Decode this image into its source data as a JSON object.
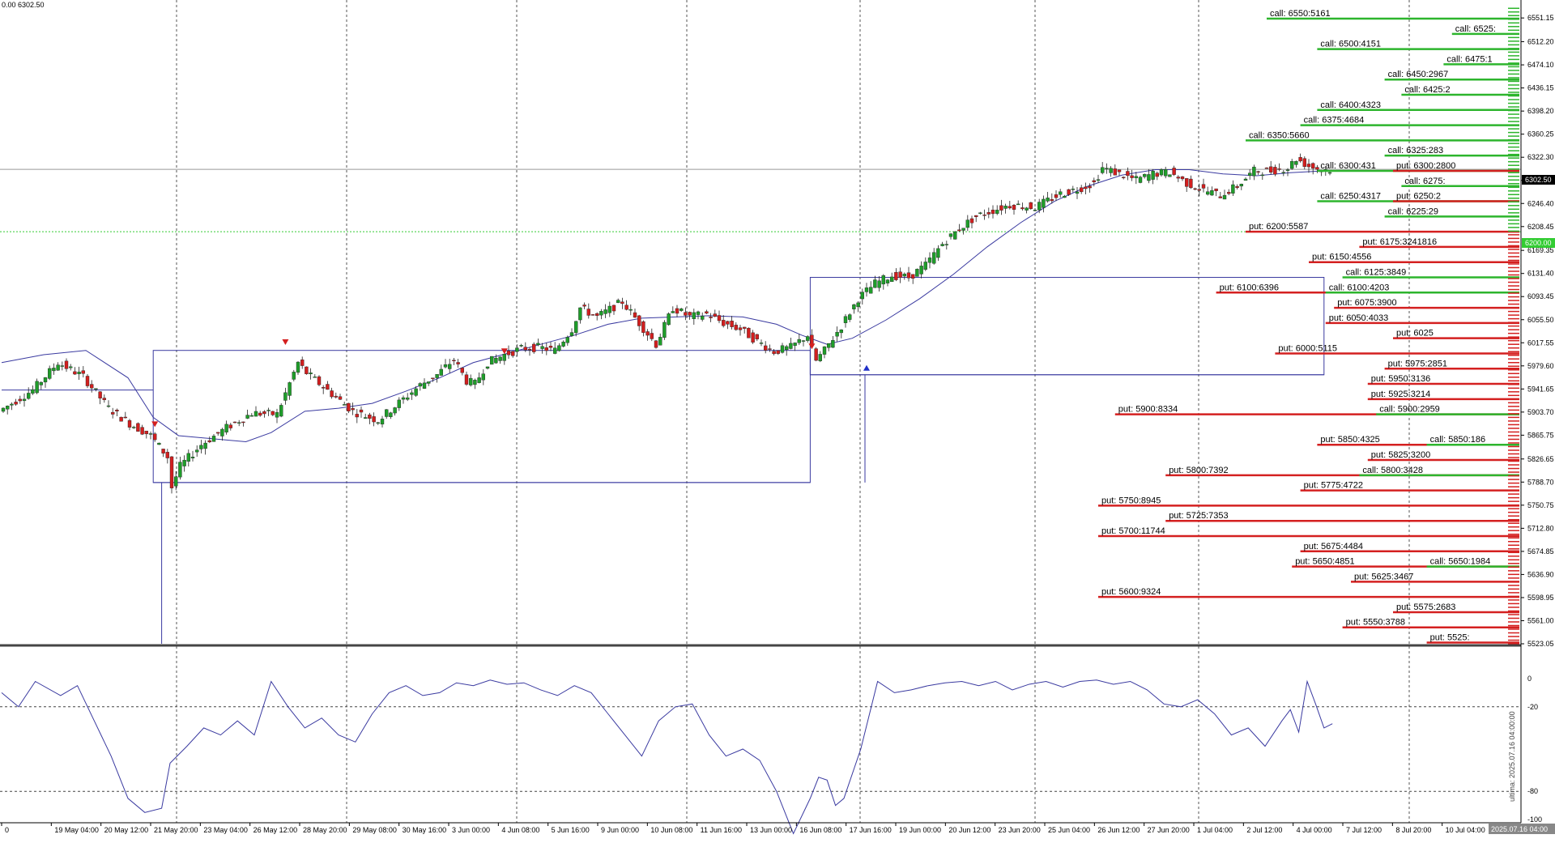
{
  "chart_header": "0.00 6302.50",
  "current_price_label": "6302.50",
  "level_marker_label": "6200.00",
  "vertical_caption": "ultima: 2025.07.16 04:00:00",
  "corner_date_label": "2025.07.16 04:00",
  "colors": {
    "background": "#ffffff",
    "bull": "#1f9d2a",
    "bear": "#d21f1f",
    "ma": "#3a3aa0",
    "call_line": "#2db52d",
    "put_line": "#d42020",
    "grid": "#555555",
    "level_marker": "#33cc33",
    "indicator": "#3a3aa0"
  },
  "chart_data": {
    "type": "candlestick",
    "price_axis": {
      "ylim": [
        5523.05,
        6570
      ],
      "ticks": [
        "6551.15",
        "6512.20",
        "6474.10",
        "6436.15",
        "6398.20",
        "6360.25",
        "6322.30",
        "6284.35",
        "6246.40",
        "6208.45",
        "6169.35",
        "6131.40",
        "6093.45",
        "6055.50",
        "6017.55",
        "5979.60",
        "5941.65",
        "5903.70",
        "5865.75",
        "5826.65",
        "5788.70",
        "5750.75",
        "5712.80",
        "5674.85",
        "5636.90",
        "5598.95",
        "5561.00",
        "5523.05"
      ]
    },
    "time_axis": {
      "labels": [
        "0",
        "19 May 04:00",
        "20 May 12:00",
        "21 May 20:00",
        "23 May 04:00",
        "26 May 12:00",
        "28 May 20:00",
        "29 May 08:00",
        "30 May 16:00",
        "3 Jun 00:00",
        "4 Jun 08:00",
        "5 Jun 16:00",
        "9 Jun 00:00",
        "10 Jun 08:00",
        "11 Jun 16:00",
        "13 Jun 00:00",
        "16 Jun 08:00",
        "17 Jun 16:00",
        "19 Jun 00:00",
        "20 Jun 12:00",
        "23 Jun 20:00",
        "25 Jun 04:00",
        "26 Jun 12:00",
        "27 Jun 20:00",
        "1 Jul 04:00",
        "2 Jul 12:00",
        "4 Jul 00:00",
        "7 Jul 12:00",
        "8 Jul 20:00",
        "10 Jul 04:00"
      ]
    },
    "price_path": [
      [
        0,
        5905
      ],
      [
        8,
        5940
      ],
      [
        14,
        5985
      ],
      [
        20,
        5962
      ],
      [
        26,
        5910
      ],
      [
        31,
        5885
      ],
      [
        36,
        5865
      ],
      [
        40,
        5830
      ],
      [
        41,
        5780
      ],
      [
        43,
        5815
      ],
      [
        48,
        5850
      ],
      [
        54,
        5878
      ],
      [
        60,
        5902
      ],
      [
        66,
        5900
      ],
      [
        71,
        5985
      ],
      [
        73,
        5968
      ],
      [
        77,
        5945
      ],
      [
        84,
        5905
      ],
      [
        90,
        5890
      ],
      [
        96,
        5925
      ],
      [
        100,
        5948
      ],
      [
        104,
        5965
      ],
      [
        108,
        5990
      ],
      [
        111,
        5955
      ],
      [
        113,
        5950
      ],
      [
        116,
        5985
      ],
      [
        120,
        5998
      ],
      [
        124,
        6008
      ],
      [
        128,
        6010
      ],
      [
        132,
        6005
      ],
      [
        136,
        6040
      ],
      [
        138,
        6075
      ],
      [
        142,
        6060
      ],
      [
        148,
        6085
      ],
      [
        152,
        6050
      ],
      [
        156,
        6015
      ],
      [
        160,
        6075
      ],
      [
        164,
        6060
      ],
      [
        168,
        6065
      ],
      [
        172,
        6050
      ],
      [
        176,
        6040
      ],
      [
        180,
        6020
      ],
      [
        184,
        6003
      ],
      [
        188,
        6010
      ],
      [
        192,
        6030
      ],
      [
        194,
        5988
      ],
      [
        196,
        6005
      ],
      [
        200,
        6045
      ],
      [
        204,
        6090
      ],
      [
        208,
        6115
      ],
      [
        212,
        6128
      ],
      [
        216,
        6125
      ],
      [
        220,
        6145
      ],
      [
        224,
        6180
      ],
      [
        228,
        6205
      ],
      [
        232,
        6225
      ],
      [
        236,
        6235
      ],
      [
        240,
        6244
      ],
      [
        246,
        6240
      ],
      [
        252,
        6262
      ],
      [
        256,
        6270
      ],
      [
        260,
        6280
      ],
      [
        262,
        6305
      ],
      [
        266,
        6295
      ],
      [
        270,
        6285
      ],
      [
        274,
        6295
      ],
      [
        278,
        6298
      ],
      [
        282,
        6280
      ],
      [
        286,
        6268
      ],
      [
        290,
        6260
      ],
      [
        294,
        6275
      ],
      [
        298,
        6300
      ],
      [
        302,
        6300
      ],
      [
        306,
        6305
      ],
      [
        308,
        6320
      ],
      [
        311,
        6308
      ],
      [
        314,
        6302
      ]
    ],
    "moving_average": [
      [
        0,
        5985
      ],
      [
        10,
        5998
      ],
      [
        20,
        6005
      ],
      [
        30,
        5960
      ],
      [
        36,
        5895
      ],
      [
        42,
        5865
      ],
      [
        50,
        5860
      ],
      [
        58,
        5855
      ],
      [
        64,
        5870
      ],
      [
        72,
        5905
      ],
      [
        80,
        5910
      ],
      [
        88,
        5918
      ],
      [
        96,
        5938
      ],
      [
        104,
        5960
      ],
      [
        112,
        5985
      ],
      [
        120,
        6000
      ],
      [
        128,
        6015
      ],
      [
        136,
        6030
      ],
      [
        144,
        6048
      ],
      [
        152,
        6058
      ],
      [
        160,
        6060
      ],
      [
        168,
        6062
      ],
      [
        176,
        6060
      ],
      [
        184,
        6048
      ],
      [
        190,
        6030
      ],
      [
        196,
        6015
      ],
      [
        202,
        6025
      ],
      [
        210,
        6055
      ],
      [
        218,
        6090
      ],
      [
        226,
        6130
      ],
      [
        234,
        6175
      ],
      [
        242,
        6215
      ],
      [
        250,
        6250
      ],
      [
        258,
        6275
      ],
      [
        266,
        6293
      ],
      [
        274,
        6302
      ],
      [
        282,
        6302
      ],
      [
        290,
        6295
      ],
      [
        298,
        6292
      ],
      [
        306,
        6297
      ],
      [
        314,
        6300
      ]
    ],
    "range_boxes": [
      {
        "x": [
          0,
          36
        ],
        "y": [
          5940,
          5940
        ]
      },
      {
        "x": [
          36,
          192
        ],
        "y": [
          5788,
          6005
        ]
      },
      {
        "x": [
          192,
          314
        ],
        "y": [
          5965,
          6125
        ]
      }
    ],
    "signal_arrows": [
      {
        "bar": 36,
        "type": "sell",
        "price": 5875
      },
      {
        "bar": 67,
        "type": "sell",
        "price": 6010
      },
      {
        "bar": 119,
        "type": "sell",
        "price": 5995
      },
      {
        "bar": 192,
        "type": "sell",
        "price": 6003
      },
      {
        "bar": 205,
        "type": "buy",
        "price": 5985
      }
    ],
    "indicator": {
      "ylim": [
        -100,
        0
      ],
      "ticks": [
        "0",
        "-20",
        "-80",
        "-100"
      ],
      "levels": [
        -20,
        -80
      ],
      "values": [
        [
          0,
          -10
        ],
        [
          4,
          -20
        ],
        [
          8,
          -2
        ],
        [
          14,
          -12
        ],
        [
          18,
          -5
        ],
        [
          22,
          -30
        ],
        [
          26,
          -55
        ],
        [
          30,
          -85
        ],
        [
          34,
          -95
        ],
        [
          38,
          -92
        ],
        [
          40,
          -60
        ],
        [
          44,
          -48
        ],
        [
          48,
          -35
        ],
        [
          52,
          -40
        ],
        [
          56,
          -30
        ],
        [
          60,
          -40
        ],
        [
          64,
          -2
        ],
        [
          68,
          -20
        ],
        [
          72,
          -35
        ],
        [
          76,
          -28
        ],
        [
          80,
          -40
        ],
        [
          84,
          -45
        ],
        [
          88,
          -25
        ],
        [
          92,
          -10
        ],
        [
          96,
          -5
        ],
        [
          100,
          -12
        ],
        [
          104,
          -10
        ],
        [
          108,
          -3
        ],
        [
          112,
          -5
        ],
        [
          116,
          -1
        ],
        [
          120,
          -4
        ],
        [
          124,
          -3
        ],
        [
          128,
          -8
        ],
        [
          132,
          -12
        ],
        [
          136,
          -5
        ],
        [
          140,
          -10
        ],
        [
          144,
          -25
        ],
        [
          148,
          -40
        ],
        [
          152,
          -55
        ],
        [
          156,
          -30
        ],
        [
          160,
          -20
        ],
        [
          164,
          -18
        ],
        [
          168,
          -40
        ],
        [
          172,
          -55
        ],
        [
          176,
          -50
        ],
        [
          180,
          -58
        ],
        [
          184,
          -80
        ],
        [
          188,
          -110
        ],
        [
          192,
          -85
        ],
        [
          194,
          -70
        ],
        [
          196,
          -72
        ],
        [
          198,
          -90
        ],
        [
          200,
          -85
        ],
        [
          204,
          -50
        ],
        [
          208,
          -2
        ],
        [
          212,
          -10
        ],
        [
          216,
          -8
        ],
        [
          220,
          -5
        ],
        [
          224,
          -3
        ],
        [
          228,
          -2
        ],
        [
          232,
          -5
        ],
        [
          236,
          -2
        ],
        [
          240,
          -8
        ],
        [
          244,
          -4
        ],
        [
          248,
          -2
        ],
        [
          252,
          -6
        ],
        [
          256,
          -2
        ],
        [
          260,
          -1
        ],
        [
          264,
          -4
        ],
        [
          268,
          -2
        ],
        [
          272,
          -8
        ],
        [
          276,
          -18
        ],
        [
          280,
          -20
        ],
        [
          284,
          -15
        ],
        [
          288,
          -25
        ],
        [
          292,
          -40
        ],
        [
          296,
          -35
        ],
        [
          300,
          -48
        ],
        [
          304,
          -30
        ],
        [
          306,
          -22
        ],
        [
          308,
          -38
        ],
        [
          310,
          -2
        ],
        [
          312,
          -18
        ],
        [
          314,
          -35
        ],
        [
          316,
          -32
        ]
      ]
    },
    "option_levels": [
      {
        "label": "call: 6550:5161",
        "type": "call",
        "strike": 6550,
        "length": 0.6
      },
      {
        "label": "call: 6525:",
        "type": "call",
        "strike": 6525,
        "length": 0.16
      },
      {
        "label": "call: 6500:4151",
        "type": "call",
        "strike": 6500,
        "length": 0.48
      },
      {
        "label": "call: 6475:1",
        "type": "call",
        "strike": 6475,
        "length": 0.18
      },
      {
        "label": "call: 6450:2967",
        "type": "call",
        "strike": 6450,
        "length": 0.32
      },
      {
        "label": "call: 6425:2",
        "type": "call",
        "strike": 6425,
        "length": 0.28
      },
      {
        "label": "call: 6400:4323",
        "type": "call",
        "strike": 6400,
        "length": 0.48
      },
      {
        "label": "call: 6375:4684",
        "type": "call",
        "strike": 6375,
        "length": 0.52
      },
      {
        "label": "call: 6350:5660",
        "type": "call",
        "strike": 6350,
        "length": 0.65
      },
      {
        "label": "call: 6325:283",
        "type": "call",
        "strike": 6325,
        "length": 0.32
      },
      {
        "label": "call: 6300:431",
        "type": "call",
        "strike": 6300,
        "length": 0.48
      },
      {
        "label": "put: 6300:2800",
        "type": "put",
        "strike": 6300,
        "length": 0.3
      },
      {
        "label": "call: 6275:",
        "type": "call",
        "strike": 6275,
        "length": 0.28
      },
      {
        "label": "call: 6250:4317",
        "type": "call",
        "strike": 6250,
        "length": 0.48
      },
      {
        "label": "put: 6250:2",
        "type": "put",
        "strike": 6250,
        "length": 0.3
      },
      {
        "label": "call: 6225:29",
        "type": "call",
        "strike": 6225,
        "length": 0.32
      },
      {
        "label": "put: 6200:5587",
        "type": "put",
        "strike": 6200,
        "length": 0.65
      },
      {
        "label": "put: 6175:3241816",
        "type": "put",
        "strike": 6175,
        "length": 0.38
      },
      {
        "label": "put: 6150:4556",
        "type": "put",
        "strike": 6150,
        "length": 0.5
      },
      {
        "label": "call: 6125:3849",
        "type": "call",
        "strike": 6125,
        "length": 0.42
      },
      {
        "label": "put: 6100:6396",
        "type": "put",
        "strike": 6100,
        "length": 0.72
      },
      {
        "label": "call: 6100:4203",
        "type": "call",
        "strike": 6100,
        "length": 0.46
      },
      {
        "label": "put: 6075:3900",
        "type": "put",
        "strike": 6075,
        "length": 0.44
      },
      {
        "label": "put: 6050:4033",
        "type": "put",
        "strike": 6050,
        "length": 0.46
      },
      {
        "label": "put: 6025",
        "type": "put",
        "strike": 6025,
        "length": 0.3
      },
      {
        "label": "put: 6000:5115",
        "type": "put",
        "strike": 6000,
        "length": 0.58
      },
      {
        "label": "put: 5975:2851",
        "type": "put",
        "strike": 5975,
        "length": 0.32
      },
      {
        "label": "put: 5950:3136",
        "type": "put",
        "strike": 5950,
        "length": 0.36
      },
      {
        "label": "put: 5925:3214",
        "type": "put",
        "strike": 5925,
        "length": 0.36
      },
      {
        "label": "put: 5900:8334",
        "type": "put",
        "strike": 5900,
        "length": 0.96
      },
      {
        "label": "call: 5900:2959",
        "type": "call",
        "strike": 5900,
        "length": 0.34
      },
      {
        "label": "put: 5850:4325",
        "type": "put",
        "strike": 5850,
        "length": 0.48
      },
      {
        "label": "call: 5850:186",
        "type": "call",
        "strike": 5850,
        "length": 0.22
      },
      {
        "label": "put: 5825:3200",
        "type": "put",
        "strike": 5825,
        "length": 0.36
      },
      {
        "label": "put: 5800:7392",
        "type": "put",
        "strike": 5800,
        "length": 0.84
      },
      {
        "label": "call: 5800:3428",
        "type": "call",
        "strike": 5800,
        "length": 0.38
      },
      {
        "label": "put: 5775:4722",
        "type": "put",
        "strike": 5775,
        "length": 0.52
      },
      {
        "label": "put: 5750:8945",
        "type": "put",
        "strike": 5750,
        "length": 1.0
      },
      {
        "label": "put: 5725:7353",
        "type": "put",
        "strike": 5725,
        "length": 0.84
      },
      {
        "label": "put: 5700:11744",
        "type": "put",
        "strike": 5700,
        "length": 1.0
      },
      {
        "label": "put: 5675:4484",
        "type": "put",
        "strike": 5675,
        "length": 0.52
      },
      {
        "label": "put: 5650:4851",
        "type": "put",
        "strike": 5650,
        "length": 0.54
      },
      {
        "label": "call: 5650:1984",
        "type": "call",
        "strike": 5650,
        "length": 0.22
      },
      {
        "label": "put: 5625:3467",
        "type": "put",
        "strike": 5625,
        "length": 0.4
      },
      {
        "label": "put: 5600:9324",
        "type": "put",
        "strike": 5600,
        "length": 1.0
      },
      {
        "label": "put: 5575:2683",
        "type": "put",
        "strike": 5575,
        "length": 0.3
      },
      {
        "label": "put: 5550:3788",
        "type": "put",
        "strike": 5550,
        "length": 0.42
      },
      {
        "label": "put: 5525:",
        "type": "put",
        "strike": 5525,
        "length": 0.22
      }
    ]
  }
}
